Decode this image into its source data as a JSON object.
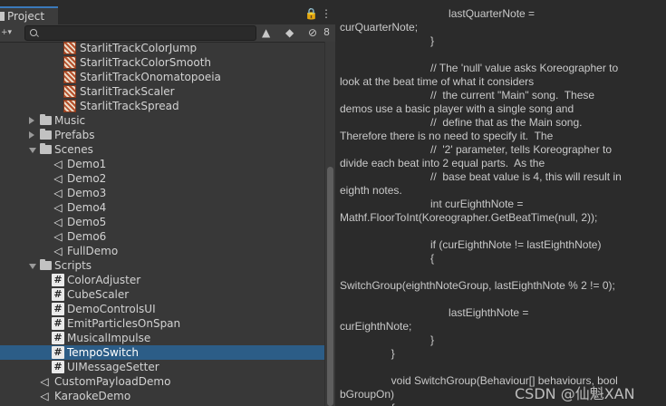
{
  "tab": {
    "title": "Project"
  },
  "toolbar": {
    "count": "8"
  },
  "tree": [
    {
      "label": "StarlitTrackColorJump",
      "icon": "asset-icon"
    },
    {
      "label": "StarlitTrackColorSmooth",
      "icon": "asset-icon"
    },
    {
      "label": "StarlitTrackOnomatopoeia",
      "icon": "asset-icon"
    },
    {
      "label": "StarlitTrackScaler",
      "icon": "asset-icon"
    },
    {
      "label": "StarlitTrackSpread",
      "icon": "asset-icon"
    },
    {
      "label": "Music",
      "icon": "folder-icon",
      "expanded": false
    },
    {
      "label": "Prefabs",
      "icon": "folder-icon",
      "expanded": false
    },
    {
      "label": "Scenes",
      "icon": "folder-icon",
      "expanded": true
    },
    {
      "label": "Demo1",
      "icon": "unity-scene-icon"
    },
    {
      "label": "Demo2",
      "icon": "unity-scene-icon"
    },
    {
      "label": "Demo3",
      "icon": "unity-scene-icon"
    },
    {
      "label": "Demo4",
      "icon": "unity-scene-icon"
    },
    {
      "label": "Demo5",
      "icon": "unity-scene-icon"
    },
    {
      "label": "Demo6",
      "icon": "unity-scene-icon"
    },
    {
      "label": "FullDemo",
      "icon": "unity-scene-icon"
    },
    {
      "label": "Scripts",
      "icon": "folder-icon",
      "expanded": true
    },
    {
      "label": "ColorAdjuster",
      "icon": "csharp-script-icon"
    },
    {
      "label": "CubeScaler",
      "icon": "csharp-script-icon"
    },
    {
      "label": "DemoControlsUI",
      "icon": "csharp-script-icon"
    },
    {
      "label": "EmitParticlesOnSpan",
      "icon": "csharp-script-icon"
    },
    {
      "label": "MusicalImpulse",
      "icon": "csharp-script-icon"
    },
    {
      "label": "TempoSwitch",
      "icon": "csharp-script-icon",
      "selected": true
    },
    {
      "label": "UIMessageSetter",
      "icon": "csharp-script-icon"
    },
    {
      "label": "CustomPayloadDemo",
      "icon": "unity-scene-icon"
    },
    {
      "label": "KaraokeDemo",
      "icon": "unity-scene-icon"
    }
  ],
  "code_lines": [
    "                                    lastQuarterNote =",
    "curQuarterNote;",
    "                              }",
    "",
    "                              // The 'null' value asks Koreographer to",
    "look at the beat time of what it considers",
    "                              //  the current \"Main\" song.  These",
    "demos use a basic player with a single song and",
    "                              //  define that as the Main song.",
    "Therefore there is no need to specify it.  The",
    "                              //  '2' parameter, tells Koreographer to",
    "divide each beat into 2 equal parts.  As the",
    "                              //  base beat value is 4, this will result in",
    "eighth notes.",
    "                              int curEighthNote =",
    "Mathf.FloorToInt(Koreographer.GetBeatTime(null, 2));",
    "",
    "                              if (curEighthNote != lastEighthNote)",
    "                              {",
    "",
    "SwitchGroup(eighthNoteGroup, lastEighthNote % 2 != 0);",
    "",
    "                                    lastEighthNote =",
    "curEighthNote;",
    "                              }",
    "                 }",
    "",
    "                 void SwitchGroup(Behaviour[] behaviours, bool",
    "bGroupOn)",
    "                 {"
  ],
  "watermark": "CSDN @仙魁XAN"
}
